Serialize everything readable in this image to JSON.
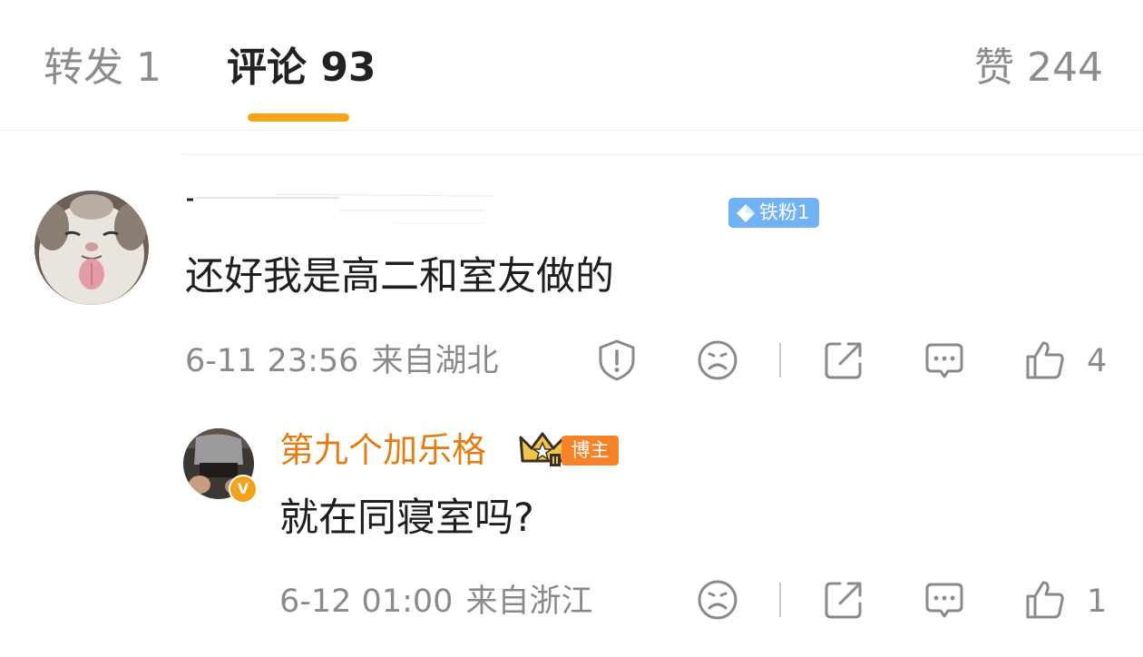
{
  "tabs": {
    "repost": "转发 1",
    "comments": "评论 93",
    "likes": "赞 244",
    "active": "comments"
  },
  "comment": {
    "username": "",
    "fan_badge": "铁粉1",
    "text": "还好我是高二和室友做的",
    "time": "6-11 23:56",
    "location": "来自湖北",
    "like_count": "4",
    "icons": [
      "report-icon",
      "sad-face-icon",
      "share-icon",
      "reply-bubble-icon",
      "thumbs-up-icon"
    ]
  },
  "reply": {
    "username": "第九个加乐格",
    "owner_badge": "博主",
    "verified_mark": "V",
    "text": "就在同寝室吗?",
    "time": "6-12 01:00",
    "location": "来自浙江",
    "like_count": "1",
    "icons": [
      "sad-face-icon",
      "share-icon",
      "reply-bubble-icon",
      "thumbs-up-icon"
    ]
  },
  "colors": {
    "accent": "#f6a519",
    "username_orange": "#e37c12",
    "fan_badge_blue": "#70b2f4",
    "owner_badge_orange": "#f7822a",
    "meta_gray": "#8a8a8a"
  }
}
